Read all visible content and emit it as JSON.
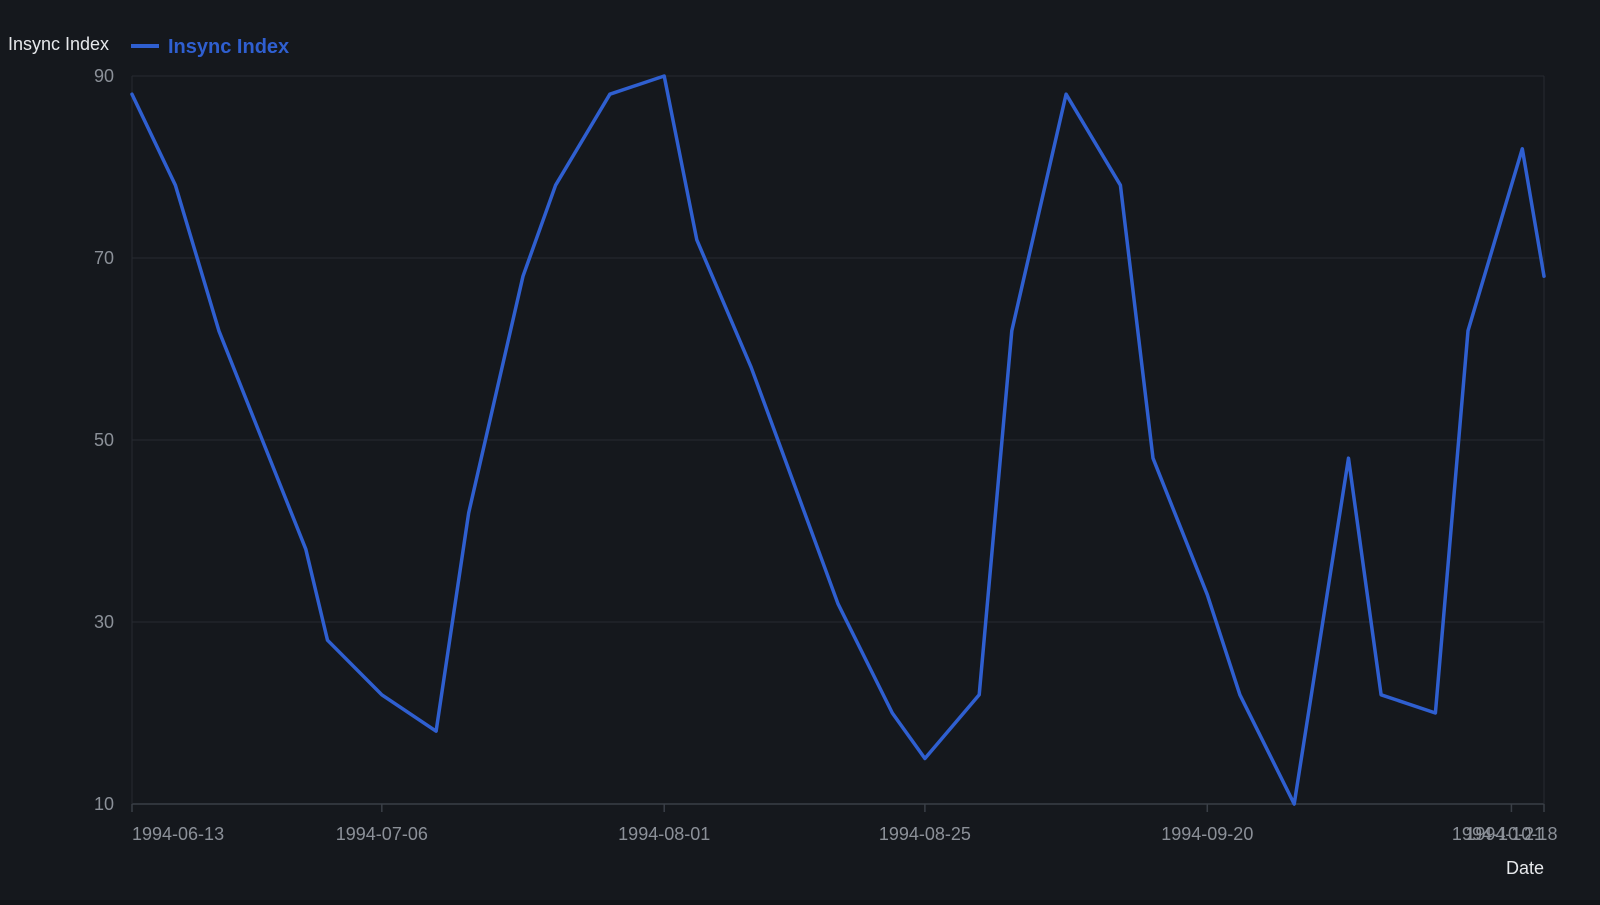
{
  "colors": {
    "background": "#15181d",
    "grid": "#262a31",
    "axis": "#3a3f47",
    "series": "#2f5fd0",
    "tick_text": "#8b9098",
    "title_text": "#e6e8eb"
  },
  "chart_data": {
    "type": "line",
    "ylabel": "Insync Index",
    "xlabel": "Date",
    "ylim": [
      10,
      90
    ],
    "yticks": [
      10,
      30,
      50,
      70,
      90
    ],
    "xlim": [
      "1994-06-13",
      "1994-10-21"
    ],
    "xticks": [
      "1994-06-13",
      "1994-07-06",
      "1994-08-01",
      "1994-08-25",
      "1994-09-20",
      "1994-10-18",
      "1994-10-21"
    ],
    "grid": true,
    "legend": "top-left",
    "series": [
      {
        "name": "Insync Index",
        "color": "#2f5fd0",
        "points": [
          {
            "x": "1994-06-13",
            "y": 88
          },
          {
            "x": "1994-06-17",
            "y": 78
          },
          {
            "x": "1994-06-21",
            "y": 62
          },
          {
            "x": "1994-06-25",
            "y": 50
          },
          {
            "x": "1994-06-29",
            "y": 38
          },
          {
            "x": "1994-07-01",
            "y": 28
          },
          {
            "x": "1994-07-06",
            "y": 22
          },
          {
            "x": "1994-07-11",
            "y": 18
          },
          {
            "x": "1994-07-14",
            "y": 42
          },
          {
            "x": "1994-07-19",
            "y": 68
          },
          {
            "x": "1994-07-22",
            "y": 78
          },
          {
            "x": "1994-07-27",
            "y": 88
          },
          {
            "x": "1994-08-01",
            "y": 90
          },
          {
            "x": "1994-08-04",
            "y": 72
          },
          {
            "x": "1994-08-09",
            "y": 58
          },
          {
            "x": "1994-08-13",
            "y": 45
          },
          {
            "x": "1994-08-17",
            "y": 32
          },
          {
            "x": "1994-08-22",
            "y": 20
          },
          {
            "x": "1994-08-25",
            "y": 15
          },
          {
            "x": "1994-08-30",
            "y": 22
          },
          {
            "x": "1994-09-02",
            "y": 62
          },
          {
            "x": "1994-09-07",
            "y": 88
          },
          {
            "x": "1994-09-12",
            "y": 78
          },
          {
            "x": "1994-09-15",
            "y": 48
          },
          {
            "x": "1994-09-20",
            "y": 33
          },
          {
            "x": "1994-09-23",
            "y": 22
          },
          {
            "x": "1994-09-28",
            "y": 10
          },
          {
            "x": "1994-10-03",
            "y": 48
          },
          {
            "x": "1994-10-06",
            "y": 22
          },
          {
            "x": "1994-10-11",
            "y": 20
          },
          {
            "x": "1994-10-14",
            "y": 62
          },
          {
            "x": "1994-10-19",
            "y": 82
          },
          {
            "x": "1994-10-21",
            "y": 68
          }
        ]
      }
    ]
  }
}
